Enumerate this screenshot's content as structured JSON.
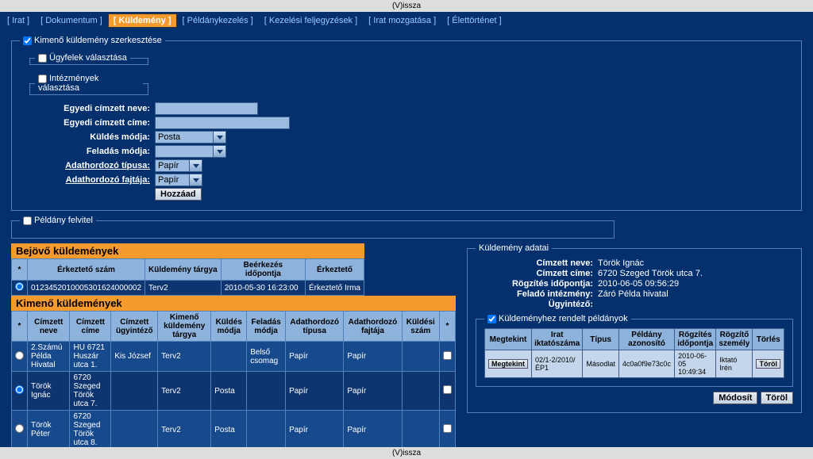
{
  "header_back": "(V)issza",
  "tabs": [
    "[ Irat ]",
    "[ Dokumentum ]",
    "[ Küldemény ]",
    "[ Példánykezelés ]",
    "[ Kezelési feljegyzések ]",
    "[ Irat mozgatása ]",
    "[ Élettörténet ]"
  ],
  "active_tab": 2,
  "outgoing_fs_title": "Kimenő küldemény szerkesztése",
  "clients_choice": "Ügyfelek választása",
  "insts_choice": "Intézmények választása",
  "lbl_recipient_name": "Egyedi címzett neve:",
  "lbl_recipient_addr": "Egyedi címzett címe:",
  "lbl_send_mode": "Küldés módja:",
  "lbl_post_mode": "Feladás módja:",
  "lbl_media_type": "Adathordozó típusa:",
  "lbl_media_kind": "Adathordozó fajtája:",
  "send_mode_val": "Posta",
  "media_type_val": "Papír",
  "media_kind_val": "Papír",
  "btn_add": "Hozzáad",
  "copy_fs_title": "Példány felvitel",
  "incoming_title": "Bejövő küldemények",
  "incoming_headers": {
    "star": "*",
    "reg": "Érkeztető szám",
    "subject": "Küldemény tárgya",
    "arrival": "Beérkezés időpontja",
    "registrar": "Érkeztető"
  },
  "incoming_row": {
    "reg": "0123452010005301624000002",
    "subject": "Terv2",
    "arrival": "2010-05-30 16:23:00",
    "registrar": "Érkeztető Irma"
  },
  "outgoing_title": "Kimenő küldemények",
  "out_headers": {
    "star": "*",
    "name": "Címzett neve",
    "addr": "Címzett címe",
    "clerk": "Címzett ügyintéző",
    "subj": "Kimenő küldemény tárgya",
    "sendm": "Küldés módja",
    "postm": "Feladás módja",
    "mtype": "Adathordozó típusa",
    "mkind": "Adathordozó fajtája",
    "sendnum": "Küldési szám",
    "star2": "*"
  },
  "out_rows": [
    {
      "name": "2.Számú Példa Hivatal",
      "addr": "HU 6721 Huszár utca 1.",
      "clerk": "Kis József",
      "subj": "Terv2",
      "sendm": "",
      "postm": "Belső csomag",
      "mtype": "Papír",
      "mkind": "Papír",
      "sendnum": ""
    },
    {
      "name": "Török Ignác",
      "addr": "6720 Szeged Török utca 7.",
      "clerk": "",
      "subj": "Terv2",
      "sendm": "Posta",
      "postm": "",
      "mtype": "Papír",
      "mkind": "Papír",
      "sendnum": ""
    },
    {
      "name": "Török Péter",
      "addr": "6720 Szeged Török utca 8.",
      "clerk": "",
      "subj": "Terv2",
      "sendm": "Posta",
      "postm": "",
      "mtype": "Papír",
      "mkind": "Papír",
      "sendnum": ""
    }
  ],
  "details_fs": "Küldemény adatai",
  "d_name_l": "Címzett neve:",
  "d_name_v": "Török Ignác",
  "d_addr_l": "Címzett címe:",
  "d_addr_v": "6720 Szeged Török utca 7.",
  "d_rec_l": "Rögzítés időpontja:",
  "d_rec_v": "2010-06-05 09:56:29",
  "d_inst_l": "Feladó intézmény:",
  "d_inst_v": "Záró Példa hivatal",
  "d_clerk_l": "Ügyintéző:",
  "assigned_fs": "Küldeményhez rendelt példányok",
  "inner_h": {
    "view": "Megtekint",
    "iktat": "Irat iktatószáma",
    "type": "Típus",
    "copyid": "Példány azonosító",
    "rectime": "Rögzítés időpontja",
    "recby": "Rögzítő személy",
    "del": "Törlés"
  },
  "inner_row": {
    "view": "Megtekint",
    "iktat": "02/1-2/2010/ÉP1",
    "type": "Másodlat",
    "copyid": "4c0a0f9e73c0c",
    "rectime": "2010-06-05 10:49:34",
    "recby": "Iktató Irén",
    "del": "Töröl"
  },
  "btn_modify": "Módosít",
  "btn_delete": "Töröl",
  "footer_back": "(V)issza"
}
